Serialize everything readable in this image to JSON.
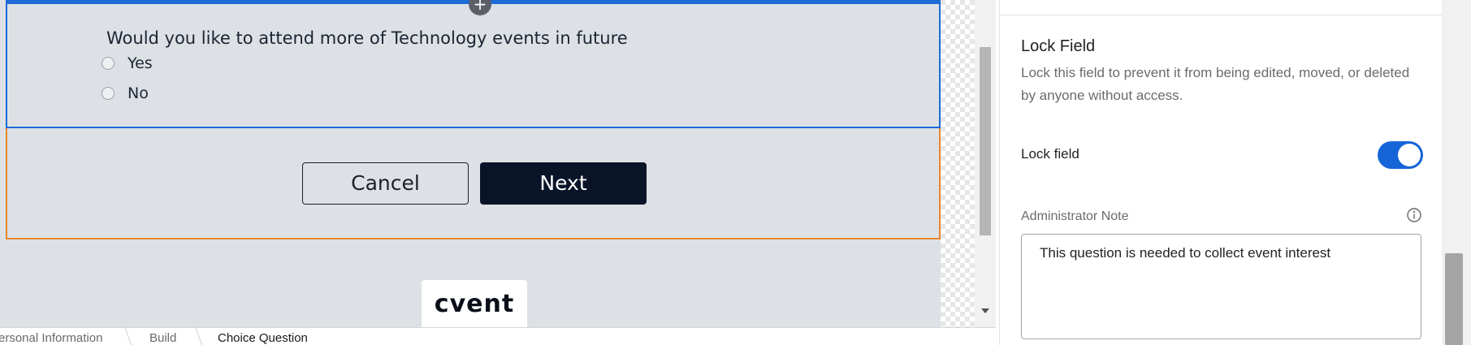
{
  "form": {
    "add_handle_glyph": "+",
    "question": "Would you like to attend more of Technology events in future",
    "options": [
      {
        "label": "Yes",
        "selected": false
      },
      {
        "label": "No",
        "selected": false
      }
    ],
    "buttons": {
      "cancel": "Cancel",
      "next": "Next"
    },
    "logo": "cvent"
  },
  "breadcrumb": [
    "Personal Information",
    "Build",
    "Choice Question"
  ],
  "panel": {
    "section_title": "Lock Field",
    "section_desc": "Lock this field to prevent it from being edited, moved, or deleted by anyone without access.",
    "lock_label": "Lock field",
    "lock_enabled": true,
    "note_label": "Administrator Note",
    "note_value": "This question is needed to collect event interest"
  },
  "colors": {
    "selected_outline": "#1c6bd6",
    "section_outline": "#e8872e",
    "primary_button": "#0a1428",
    "toggle_on": "#1565d8",
    "page_background": "#dde1e5"
  },
  "icons": [
    "add-icon",
    "info-icon",
    "scroll-down-arrow-icon"
  ]
}
